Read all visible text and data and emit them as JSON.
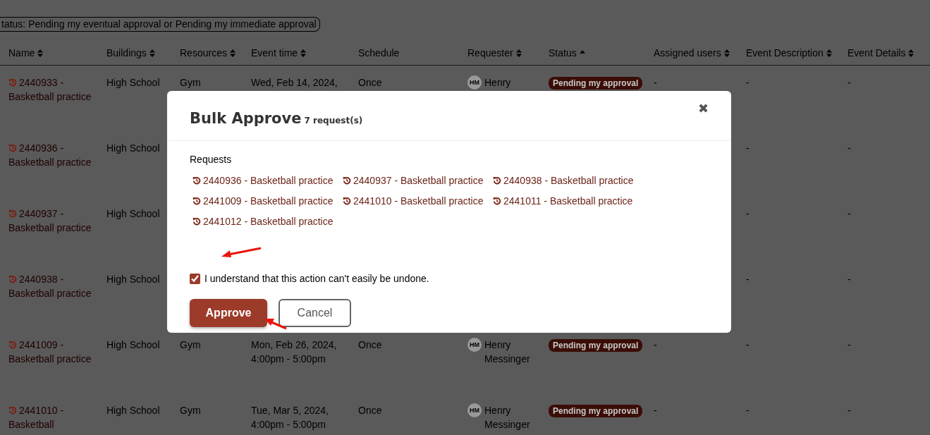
{
  "filter_chip": {
    "label": "tatus: Pending my eventual approval or Pending my immediate approval"
  },
  "table": {
    "columns": [
      {
        "label": "Name",
        "sortable": true,
        "sorted": false
      },
      {
        "label": "Buildings",
        "sortable": true,
        "sorted": false
      },
      {
        "label": "Resources",
        "sortable": true,
        "sorted": false
      },
      {
        "label": "Event time",
        "sortable": true,
        "sorted": false
      },
      {
        "label": "Schedule",
        "sortable": false,
        "sorted": false
      },
      {
        "label": "Requester",
        "sortable": true,
        "sorted": false
      },
      {
        "label": "Status",
        "sortable": true,
        "sorted": true
      },
      {
        "label": "Assigned users",
        "sortable": true,
        "sorted": false
      },
      {
        "label": "Event Description",
        "sortable": true,
        "sorted": false
      },
      {
        "label": "Event Details",
        "sortable": true,
        "sorted": false
      }
    ],
    "rows": [
      {
        "name": "2440933 - Basketball practice",
        "building": "High School",
        "resource": "Gym",
        "event_time": "Wed, Feb 14, 2024,",
        "schedule": "Once",
        "requester_initials": "HM",
        "requester": "Henry",
        "status": "Pending my approval",
        "assigned": "-",
        "description": "-",
        "details": "-"
      },
      {
        "name": "2440936 - Basketball practice",
        "building": "High School",
        "description": "-",
        "details": "-"
      },
      {
        "name": "2440937 - Basketball practice",
        "building": "High School",
        "description": "-",
        "details": "-"
      },
      {
        "name": "2440938 - Basketball practice",
        "building": "High School",
        "description": "-",
        "details": "-"
      },
      {
        "name": "2441009 - Basketball practice",
        "building": "High School",
        "resource": "Gym",
        "event_time": "Mon, Feb 26, 2024, 4:00pm - 5:00pm",
        "schedule": "Once",
        "requester_initials": "HM",
        "requester": "Henry Messinger",
        "status": "Pending my approval",
        "assigned": "-",
        "description": "-",
        "details": "-"
      },
      {
        "name": "2441010 - Basketball",
        "building": "High School",
        "resource": "Gym",
        "event_time": "Tue, Mar 5, 2024, 4:00pm - 5:00pm",
        "schedule": "Once",
        "requester_initials": "HM",
        "requester": "Henry Messinger",
        "status": "Pending my approval",
        "assigned": "-",
        "description": "-",
        "details": "-"
      }
    ]
  },
  "modal": {
    "title": "Bulk Approve",
    "count": "7 request(s)",
    "close": "✖",
    "requests_label": "Requests",
    "requests": [
      "2440936 - Basketball practice",
      "2440937 - Basketball practice",
      "2440938 - Basketball practice",
      "2441009 - Basketball practice",
      "2441010 - Basketball practice",
      "2441011 - Basketball practice",
      "2441012 - Basketball practice"
    ],
    "confirm": {
      "label": "I understand that this action can't easily be undone.",
      "checked": true
    },
    "buttons": [
      {
        "label": "Approve",
        "kind": "primary"
      },
      {
        "label": "Cancel",
        "kind": "secondary"
      }
    ]
  }
}
